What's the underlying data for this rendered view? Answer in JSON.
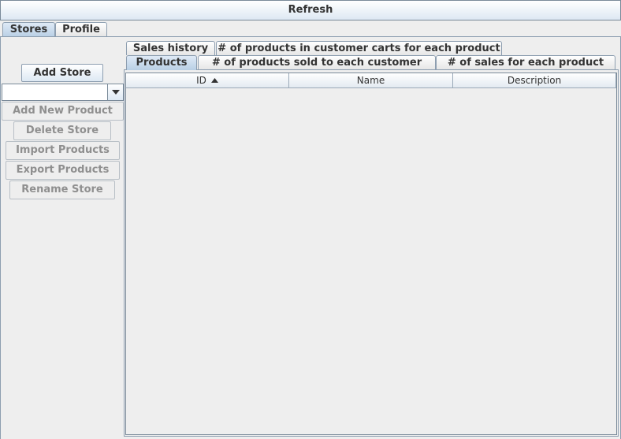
{
  "toolbar": {
    "refresh_label": "Refresh"
  },
  "top_tabs": [
    {
      "label": "Stores",
      "selected": true
    },
    {
      "label": "Profile",
      "selected": false
    }
  ],
  "sidebar": {
    "add_store_label": "Add Store",
    "store_select_value": "",
    "buttons": [
      {
        "label": "Add New Product",
        "enabled": false
      },
      {
        "label": "Delete Store",
        "enabled": false
      },
      {
        "label": "Import Products",
        "enabled": false
      },
      {
        "label": "Export Products",
        "enabled": false
      },
      {
        "label": "Rename Store",
        "enabled": false
      }
    ]
  },
  "content_tabs": {
    "back_row": [
      "Sales history",
      "# of products in customer carts for each product"
    ],
    "front_row": [
      "Products",
      "# of products sold to each customer",
      "# of sales for each product"
    ],
    "selected": "Products"
  },
  "table": {
    "columns": [
      "ID",
      "Name",
      "Description"
    ],
    "sort_column": "ID",
    "rows": []
  }
}
